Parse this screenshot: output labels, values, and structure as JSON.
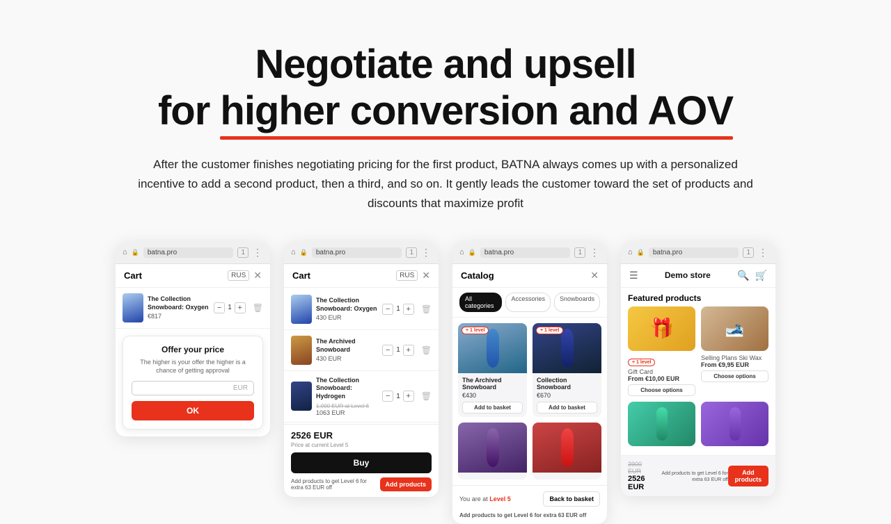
{
  "headline": {
    "line1": "Negotiate and upsell",
    "line2_pre": "for ",
    "line2_highlight": "higher conversion and AOV",
    "underline_color": "#e8321c"
  },
  "subtext": "After the customer finishes negotiating pricing for the first product, BATNA always comes up with a personalized incentive to add a second product, then a third, and so on. It gently leads the customer toward the set of products and discounts that maximize profit",
  "screenshots": [
    {
      "id": "card1",
      "browser_url": "batna.pro",
      "cart_title": "Cart",
      "lang": "RUS",
      "item1_name": "The Collection Snowboard: Oxygen",
      "item1_price": "€817",
      "offer_title": "Offer your price",
      "offer_sub": "The higher is your offer the higher is a chance of getting approval",
      "offer_placeholder": "",
      "offer_currency": "EUR",
      "offer_btn": "OK"
    },
    {
      "id": "card2",
      "browser_url": "batna.pro",
      "cart_title": "Cart",
      "lang": "RUS",
      "items": [
        {
          "name": "The Collection Snowboard: Oxygen",
          "price": "430 EUR",
          "original": ""
        },
        {
          "name": "The Archived Snowboard",
          "price": "430 EUR",
          "original": ""
        },
        {
          "name": "The Collection Snowboard: Hydrogen",
          "price": "1063 EUR",
          "original": "1.000 EUR at Level 6"
        }
      ],
      "total": "2526 EUR",
      "total_sub": "Price at current Level 5",
      "buy_btn": "Buy",
      "upsell_text": "Add products to get Level 6 for extra 63 EUR off",
      "upsell_btn": "Add products"
    },
    {
      "id": "card3",
      "browser_url": "batna.pro",
      "catalog_title": "Catalog",
      "filters": [
        "All categories",
        "Accessories",
        "Snowboards"
      ],
      "products": [
        {
          "name": "The Archived Snowboard",
          "price": "€430",
          "level_badge": "+ 1 level"
        },
        {
          "name": "Collection Snowboard",
          "price": "€670",
          "level_badge": "+ 1 level"
        }
      ],
      "level_text": "You are at Level 5",
      "back_btn": "Back to basket",
      "upsell_text": "Add products to get Level 6 for extra 63 EUR off"
    },
    {
      "id": "card4",
      "browser_url": "batna.pro",
      "store_title": "Demo store",
      "featured_title": "Featured products",
      "products": [
        {
          "name": "Gift Card",
          "from": "From €10,00 EUR",
          "type": "gift",
          "level_badge": "+ 1 level"
        },
        {
          "name": "Selling Plans Ski Wax",
          "from": "From €9,95 EUR",
          "type": "wax"
        },
        {
          "name": "",
          "from": "",
          "type": "teal-board"
        },
        {
          "name": "",
          "from": "",
          "type": "purple-board2"
        }
      ],
      "bottom_original": "3900 EUR",
      "bottom_price": "2526 EUR",
      "bottom_sub": "Add products to get Level 6 for extra 63 EUR off",
      "add_btn": "Add products"
    }
  ]
}
